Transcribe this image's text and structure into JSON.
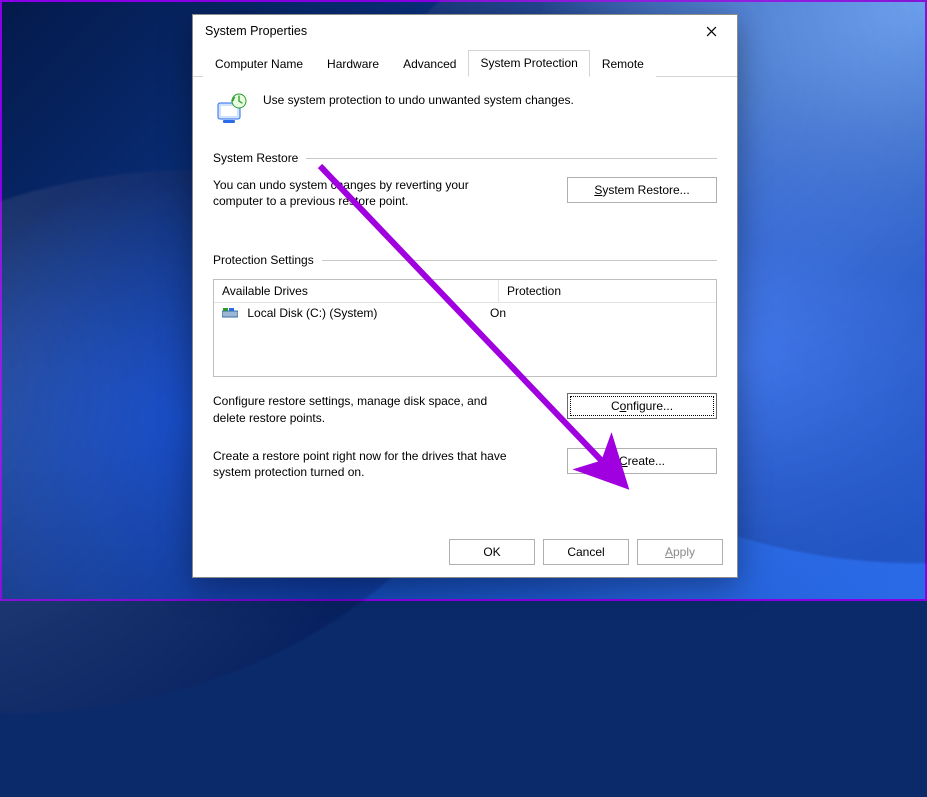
{
  "window": {
    "title": "System Properties"
  },
  "tabs": {
    "computer_name": "Computer Name",
    "hardware": "Hardware",
    "advanced": "Advanced",
    "system_protection": "System Protection",
    "remote": "Remote"
  },
  "intro": "Use system protection to undo unwanted system changes.",
  "restore": {
    "group_label": "System Restore",
    "desc": "You can undo system changes by reverting your computer to a previous restore point.",
    "button": "System Restore..."
  },
  "protection": {
    "group_label": "Protection Settings",
    "columns": {
      "drives": "Available Drives",
      "protection": "Protection"
    },
    "rows": [
      {
        "drive": "Local Disk (C:) (System)",
        "protection": "On"
      }
    ],
    "configure_desc": "Configure restore settings, manage disk space, and delete restore points.",
    "configure_button": "Configure...",
    "create_desc": "Create a restore point right now for the drives that have system protection turned on.",
    "create_button": "Create..."
  },
  "buttons": {
    "ok": "OK",
    "cancel": "Cancel",
    "apply": "Apply"
  },
  "annotation_arrow_color": "#a000e0"
}
